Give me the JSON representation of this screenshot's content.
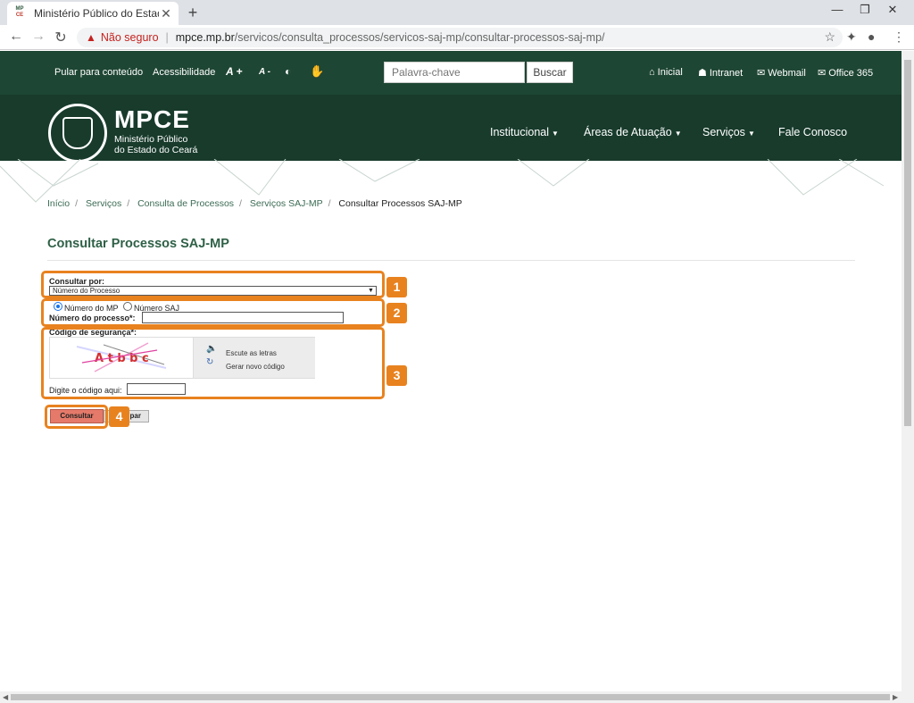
{
  "browser": {
    "tab_title": "Ministério Público do Estado do",
    "favicon_top": "MP",
    "favicon_bottom": "CE",
    "not_secure": "Não seguro",
    "url_host": "mpce.mp.br",
    "url_path": "/servicos/consulta_processos/servicos-saj-mp/consultar-processos-saj-mp/"
  },
  "topbar": {
    "skip_link": "Pular para conteúdo",
    "accessibility": "Acessibilidade",
    "font_increase": "A +",
    "font_decrease": "A -",
    "search_placeholder": "Palavra-chave",
    "search_button": "Buscar",
    "links": [
      "Inicial",
      "Intranet",
      "Webmail",
      "Office 365"
    ]
  },
  "logo": {
    "name": "MPCE",
    "line1": "Ministério Público",
    "line2": "do Estado do Ceará"
  },
  "menu": [
    "Institucional",
    "Áreas de Atuação",
    "Serviços",
    "Fale Conosco"
  ],
  "breadcrumb": [
    "Início",
    "Serviços",
    "Consulta de Processos",
    "Serviços SAJ-MP",
    "Consultar Processos SAJ-MP"
  ],
  "page_title": "Consultar Processos SAJ-MP",
  "form": {
    "consultar_por_label": "Consultar por:",
    "consultar_por_value": "Número do Processo",
    "radio_mp": "Número do MP",
    "radio_saj": "Número SAJ",
    "numero_processo_label": "Número do processo*:",
    "codigo_label": "Código de segurança*:",
    "captcha_text": "A t b b c",
    "listen_link": "Escute as letras",
    "new_code_link": "Gerar novo código",
    "digite_label": "Digite o código aqui:",
    "consultar_button": "Consultar",
    "limpar_button_visible": "par"
  },
  "badges": [
    "1",
    "2",
    "3",
    "4"
  ],
  "colors": {
    "site_green": "#1e4634",
    "highlight": "#e8821f",
    "consultar_btn": "#e57a6a"
  }
}
